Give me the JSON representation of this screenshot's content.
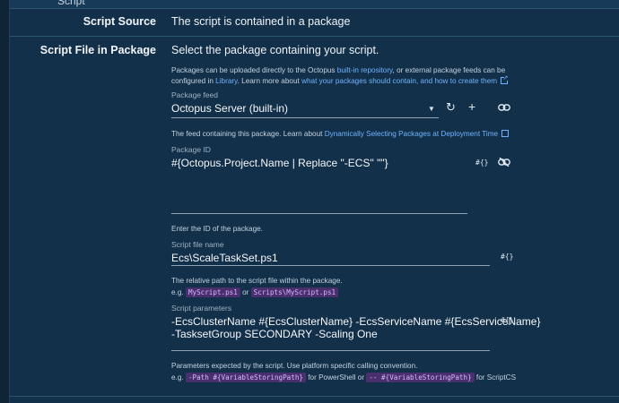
{
  "header": {
    "title": "Script"
  },
  "script_source": {
    "label": "Script Source",
    "value": "The script is contained in a package"
  },
  "script_file": {
    "label": "Script File in Package",
    "heading": "Select the package containing your script.",
    "help1_a": "Packages can be uploaded directly to the Octopus ",
    "help1_link1": "built-in repository",
    "help1_b": ", or external package feeds can be",
    "help2_a": "configured in ",
    "help2_link1": "Library",
    "help2_b": ". Learn more about ",
    "help2_link2": "what your packages should contain, and how to create them"
  },
  "package_feed": {
    "caption": "Package feed",
    "value": "Octopus Server (built-in)",
    "help_a": "The feed containing this package. Learn about ",
    "help_link": "Dynamically Selecting Packages at Deployment Time"
  },
  "package_id": {
    "caption": "Package ID",
    "value": "#{Octopus.Project.Name | Replace \"-ECS\" \"\"}",
    "hash": "#{}",
    "help": "Enter the ID of the package."
  },
  "script_file_name": {
    "caption": "Script file name",
    "value": "Ecs\\ScaleTaskSet.ps1",
    "hash": "#{}",
    "help": "The relative path to the script file within the package.",
    "eg": "e.g.",
    "ex1": "MyScript.ps1",
    "or": "or",
    "ex2": "Scripts\\MyScript.ps1"
  },
  "script_parameters": {
    "caption": "Script parameters",
    "line1": "-EcsClusterName #{EcsClusterName} -EcsServiceName #{EcsServiceName}",
    "line2": "-TasksetGroup SECONDARY -Scaling One",
    "hash": "#{}",
    "help": "Parameters expected by the script. Use platform specific calling convention.",
    "eg": "e.g.",
    "ex1": "-Path #{VariableStoringPath}",
    "mid": "for PowerShell or",
    "ex2": "-- #{VariableStoringPath}",
    "end": "for ScriptCS"
  },
  "colors": {
    "background": "#13304a",
    "link": "#6fb3ff",
    "code_bg": "#4a2f6e"
  },
  "icons": [
    "external-link-icon",
    "dropdown-arrow-icon",
    "refresh-icon",
    "add-icon",
    "link-icon",
    "unlink-icon"
  ]
}
